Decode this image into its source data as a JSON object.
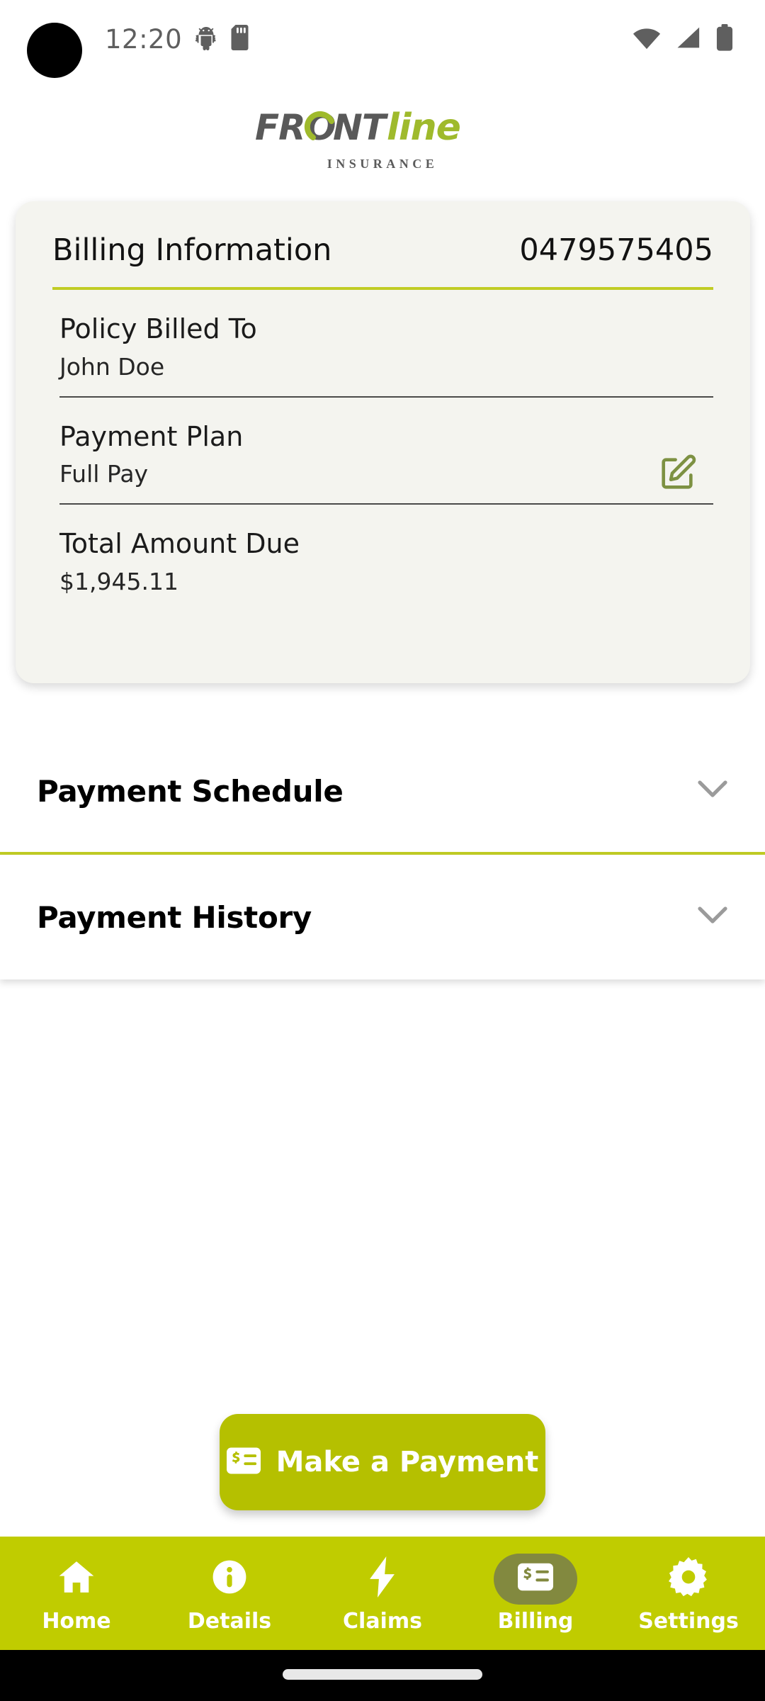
{
  "status_bar": {
    "time": "12:20",
    "icons_left": [
      "android-debug-icon",
      "sd-card-icon"
    ],
    "icons_right": [
      "wifi-icon",
      "cellular-signal-icon",
      "battery-icon"
    ]
  },
  "brand": {
    "name_front": "FRONT",
    "name_line": "line",
    "tagline": "INSURANCE",
    "color_dark": "#595959",
    "color_green": "#9fba2c"
  },
  "billing_card": {
    "title": "Billing Information",
    "policy_number": "0479575405",
    "rows": [
      {
        "label": "Policy Billed To",
        "value": "John Doe",
        "editable": false
      },
      {
        "label": "Payment Plan",
        "value": "Full Pay",
        "editable": true
      },
      {
        "label": "Total Amount Due",
        "value": "$1,945.11",
        "editable": false
      }
    ],
    "accent_color": "#c0cc24",
    "background": "#f4f4ef"
  },
  "accordions": [
    {
      "title": "Payment Schedule",
      "expanded": false,
      "chevron": "chevron-down-icon"
    },
    {
      "title": "Payment History",
      "expanded": false,
      "chevron": "chevron-down-icon"
    }
  ],
  "primary_action": {
    "label": "Make a Payment",
    "icon": "money-check-icon",
    "color": "#b5c000"
  },
  "bottom_nav": {
    "background": "#c0cc00",
    "active_pill_color": "#82893f",
    "items": [
      {
        "label": "Home",
        "icon": "home-icon",
        "active": false
      },
      {
        "label": "Details",
        "icon": "info-circle-icon",
        "active": false
      },
      {
        "label": "Claims",
        "icon": "bolt-icon",
        "active": false
      },
      {
        "label": "Billing",
        "icon": "money-check-icon",
        "active": true
      },
      {
        "label": "Settings",
        "icon": "gear-icon",
        "active": false
      }
    ]
  }
}
